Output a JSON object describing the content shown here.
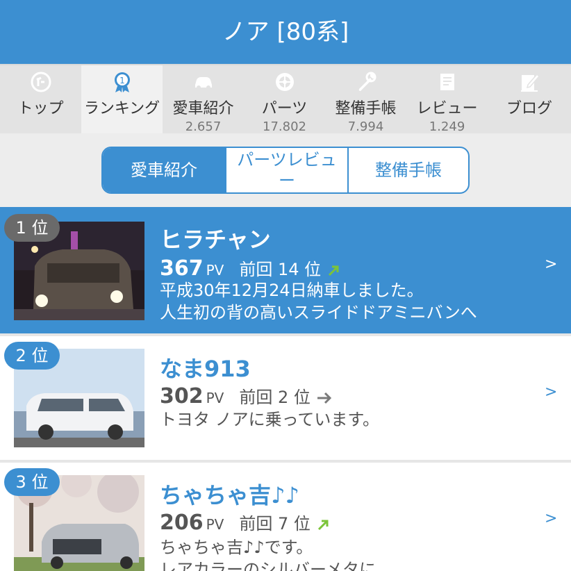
{
  "header": {
    "title": "ノア [80系]"
  },
  "tabs": [
    {
      "label": "トップ",
      "count": "",
      "icon": "top-icon"
    },
    {
      "label": "ランキング",
      "count": "",
      "icon": "ranking-medal-icon"
    },
    {
      "label": "愛車紹介",
      "count": "2.657",
      "icon": "car-icon"
    },
    {
      "label": "パーツ",
      "count": "17.802",
      "icon": "wheel-icon"
    },
    {
      "label": "整備手帳",
      "count": "7.994",
      "icon": "wrench-icon"
    },
    {
      "label": "レビュー",
      "count": "1.249",
      "icon": "review-icon"
    },
    {
      "label": "ブログ",
      "count": "",
      "icon": "blog-icon"
    }
  ],
  "segments": [
    "愛車紹介",
    "パーツレビュー",
    "整備手帳"
  ],
  "rankings": [
    {
      "rank": "1 位",
      "name": "ヒラチャン",
      "pv": "367",
      "pv_unit": "PV",
      "prev": "前回 14 位",
      "trend": "up",
      "desc": "平成30年12月24日納車しました。\n人生初の背の高いスライドドアミニバンへ",
      "chevron": ">"
    },
    {
      "rank": "2 位",
      "name": "なま913",
      "pv": "302",
      "pv_unit": "PV",
      "prev": "前回 2 位",
      "trend": "same",
      "desc": "トヨタ ノアに乗っています。",
      "chevron": ">"
    },
    {
      "rank": "3 位",
      "name": "ちゃちゃ吉♪♪",
      "pv": "206",
      "pv_unit": "PV",
      "prev": "前回 7 位",
      "trend": "up",
      "desc": "ちゃちゃ吉♪♪です。\nレアカラーのシルバーメタに",
      "chevron": ">"
    }
  ],
  "colors": {
    "primary": "#3c8fd1",
    "trend_up": "#7cc43a",
    "trend_same": "#7a7a7a"
  }
}
